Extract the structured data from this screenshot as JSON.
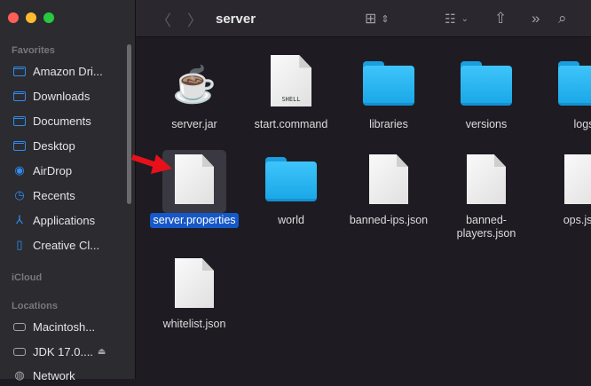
{
  "window": {
    "title": "server"
  },
  "sidebar": {
    "favorites_label": "Favorites",
    "favorites": [
      {
        "label": "Amazon Dri...",
        "icon": "folder-icon"
      },
      {
        "label": "Downloads",
        "icon": "folder-icon"
      },
      {
        "label": "Documents",
        "icon": "folder-icon"
      },
      {
        "label": "Desktop",
        "icon": "folder-icon"
      },
      {
        "label": "AirDrop",
        "icon": "airdrop-icon"
      },
      {
        "label": "Recents",
        "icon": "clock-icon"
      },
      {
        "label": "Applications",
        "icon": "applications-icon"
      },
      {
        "label": "Creative Cl...",
        "icon": "document-icon"
      }
    ],
    "icloud_label": "iCloud",
    "locations_label": "Locations",
    "locations": [
      {
        "label": "Macintosh...",
        "icon": "drive-icon"
      },
      {
        "label": "JDK 17.0....",
        "icon": "drive-icon"
      },
      {
        "label": "Network",
        "icon": "network-icon"
      }
    ]
  },
  "files": [
    {
      "name": "server.jar",
      "type": "java"
    },
    {
      "name": "start.command",
      "type": "shell",
      "badge": "SHELL"
    },
    {
      "name": "libraries",
      "type": "folder"
    },
    {
      "name": "versions",
      "type": "folder"
    },
    {
      "name": "logs",
      "type": "folder"
    },
    {
      "name": "server.properties",
      "type": "doc",
      "selected": true
    },
    {
      "name": "world",
      "type": "folder"
    },
    {
      "name": "banned-ips.json",
      "type": "doc"
    },
    {
      "name": "banned-players.json",
      "type": "doc"
    },
    {
      "name": "ops.json",
      "type": "doc"
    },
    {
      "name": "whitelist.json",
      "type": "doc"
    }
  ],
  "colors": {
    "accent": "#2f8cf0",
    "selection": "#1658c8",
    "arrow": "#e8101a"
  }
}
